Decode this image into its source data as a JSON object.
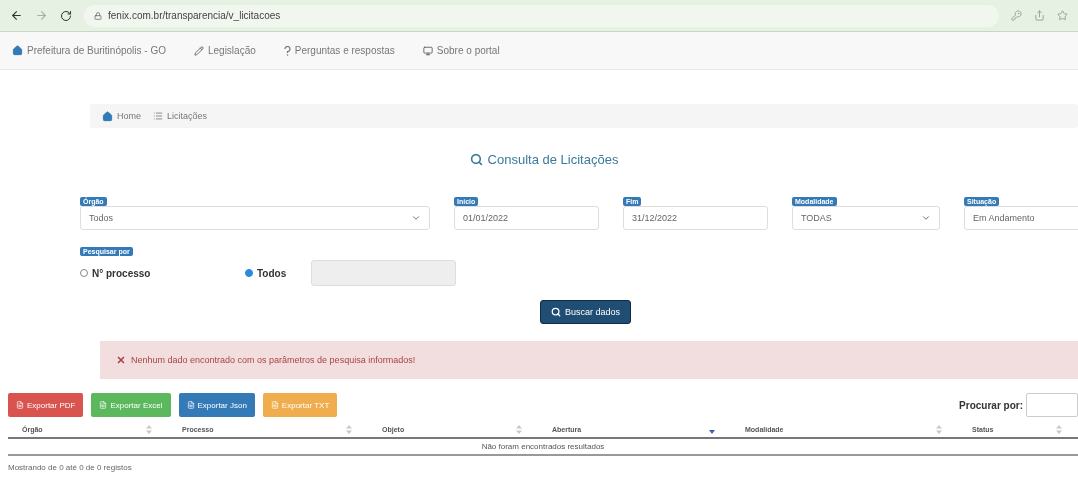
{
  "browser": {
    "url": "fenix.com.br/transparencia/v_licitacoes"
  },
  "navbar": [
    {
      "kind": "home",
      "label": "Prefeitura de Buritinópolis - GO"
    },
    {
      "kind": "pencil",
      "label": "Legislação"
    },
    {
      "kind": "question",
      "label": "Perguntas e respostas"
    },
    {
      "kind": "monitor",
      "label": "Sobre o portal"
    }
  ],
  "breadcrumb": [
    {
      "kind": "home",
      "label": "Home"
    },
    {
      "kind": "list",
      "label": "Licitações"
    }
  ],
  "page_title": "Consulta de Licitações",
  "filters": [
    {
      "kind": "select",
      "label": "Órgão",
      "value": "Todos"
    },
    {
      "kind": "input",
      "label": "Início",
      "value": "01/01/2022"
    },
    {
      "kind": "input",
      "label": "Fim",
      "value": "31/12/2022"
    },
    {
      "kind": "select",
      "label": "Modalidade",
      "value": "TODAS"
    },
    {
      "kind": "input",
      "label": "Situação",
      "value": "Em Andamento"
    }
  ],
  "search_by": {
    "label": "Pesquisar por",
    "options": [
      {
        "label": "N° processo",
        "selected": false
      },
      {
        "label": "Todos",
        "selected": true
      }
    ]
  },
  "search_button": "Buscar dados",
  "alert": "Nenhum dado encontrado com os parâmetros de pesquisa informados!",
  "export_buttons": [
    {
      "label": "Exportar PDF",
      "color": "#d9534f"
    },
    {
      "label": "Exportar Excel",
      "color": "#5cb85c"
    },
    {
      "label": "Exportar Json",
      "color": "#337ab7"
    },
    {
      "label": "Exportar TXT",
      "color": "#f0ad4e"
    }
  ],
  "table": {
    "search_label": "Procurar por:",
    "columns": [
      {
        "label": "Órgão",
        "sorted": false
      },
      {
        "label": "Processo",
        "sorted": false
      },
      {
        "label": "Objeto",
        "sorted": false
      },
      {
        "label": "Abertura",
        "sorted": true
      },
      {
        "label": "Modalidade",
        "sorted": false
      },
      {
        "label": "Status",
        "sorted": false
      }
    ],
    "empty_message": "Não foram encontrados resultados"
  },
  "footer": "Mostrando de 0 até 0 de 0 registos"
}
